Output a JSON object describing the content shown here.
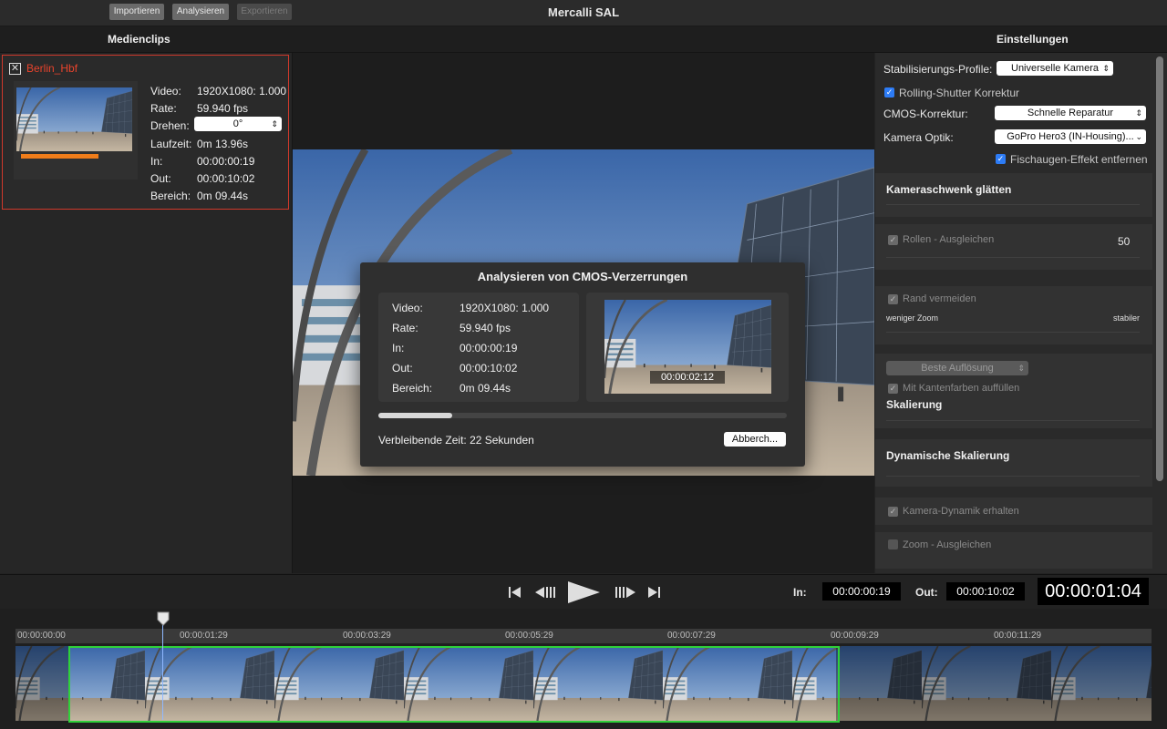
{
  "toolbar": {
    "import_label": "Importieren",
    "analyze_label": "Analysieren",
    "export_label": "Exportieren",
    "app_title": "Mercalli SAL"
  },
  "headers": {
    "mediaclips": "Medienclips",
    "settings": "Einstellungen"
  },
  "clip": {
    "name": "Berlin_Hbf",
    "labels": [
      "Video:",
      "Rate:",
      "Drehen:",
      "Laufzeit:",
      "In:",
      "Out:",
      "Bereich:"
    ],
    "video": "1920X1080: 1.000",
    "rate": "59.940 fps",
    "rotate": "0°",
    "duration": "0m 13.96s",
    "in": "00:00:00:19",
    "out": "00:00:10:02",
    "range": "0m 09.44s"
  },
  "dialog": {
    "title": "Analysieren von CMOS-Verzerrungen",
    "labels": [
      "Video:",
      "Rate:",
      "In:",
      "Out:",
      "Bereich:"
    ],
    "video": "1920X1080: 1.000",
    "rate": "59.940 fps",
    "in": "00:00:00:19",
    "out": "00:00:10:02",
    "range": "0m 09.44s",
    "preview_timecode": "00:00:02:12",
    "progress": 0.18,
    "remaining": "Verbleibende Zeit: 22 Sekunden",
    "cancel_label": "Abberch..."
  },
  "settings": {
    "profile_label": "Stabilisierungs-Profile:",
    "profile_value": "Universelle Kamera",
    "rolling_shutter": "Rolling-Shutter Korrektur",
    "cmos_label": "CMOS-Korrektur:",
    "cmos_value": "Schnelle Reparatur",
    "optics_label": "Kamera Optik:",
    "optics_value": "GoPro Hero3 (IN-Housing)...",
    "fisheye": "Fischaugen-Effekt entfernen",
    "pan_smooth": "Kameraschwenk glätten",
    "roll_comp": "Rollen - Ausgleichen",
    "roll_value": "50",
    "avoid_border": "Rand vermeiden",
    "less_zoom": "weniger Zoom",
    "more_stable": "stabiler",
    "best_res": "Beste Auflösung",
    "edge_fill": "Mit Kantenfarben auffüllen",
    "scaling": "Skalierung",
    "dynamic_scaling": "Dynamische Skalierung",
    "keep_dynamics": "Kamera-Dynamik erhalten",
    "zoom_comp": "Zoom - Ausgleichen"
  },
  "transport": {
    "in_label": "In:",
    "in_value": "00:00:00:19",
    "out_label": "Out:",
    "out_value": "00:00:10:02",
    "current": "00:00:01:04"
  },
  "timeline": {
    "ticks": [
      "00:00:00:00",
      "00:00:01:29",
      "00:00:03:29",
      "00:00:05:29",
      "00:00:07:29",
      "00:00:09:29",
      "00:00:11:29"
    ]
  },
  "colors": {
    "selection": "#2fd13a",
    "clip_border": "#d0392b",
    "clip_name": "#e8432c",
    "progress_bar": "#f07d1a",
    "checkbox": "#2d7cf6"
  }
}
